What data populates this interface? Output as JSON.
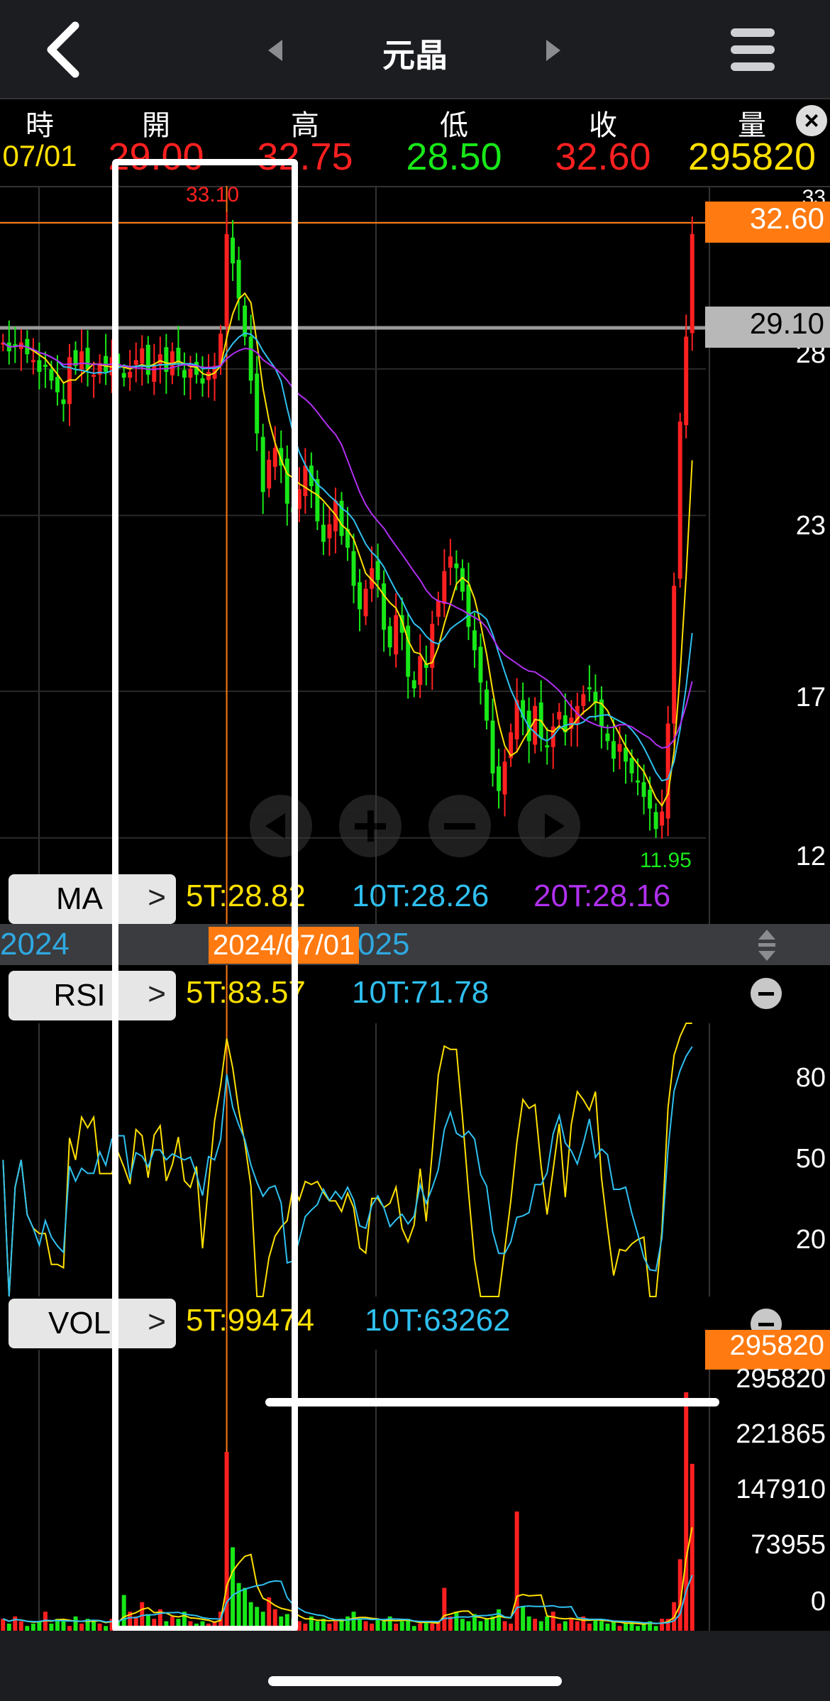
{
  "header": {
    "title": "元晶",
    "icons": [
      "back-chevron-icon",
      "prev-triangle-icon",
      "next-triangle-icon",
      "hamburger-menu-icon"
    ]
  },
  "quote": {
    "labels": [
      "時",
      "開",
      "高",
      "低",
      "收",
      "量"
    ],
    "values": [
      "07/01",
      "29.00",
      "32.75",
      "28.50",
      "32.60",
      "295820"
    ],
    "colors": [
      "#ffe000",
      "#ff2020",
      "#ff2020",
      "#18e818",
      "#ff2020",
      "#ffe000"
    ]
  },
  "price_chart": {
    "current_price_tag": "32.60",
    "ref_price_tag": "29.10",
    "high_label": "33.10",
    "low_label": "11.95",
    "axis_labels": [
      "33",
      "28",
      "23",
      "17",
      "12"
    ]
  },
  "ma": {
    "button": "MA",
    "values": [
      {
        "text": "5T:28.82",
        "color": "#ffe000"
      },
      {
        "text": "10T:28.26",
        "color": "#2fc0f0"
      },
      {
        "text": "20T:28.16",
        "color": "#b030f0"
      }
    ]
  },
  "date_axis": {
    "left_year": "2024",
    "selected_date": "2024/07/01",
    "right_year": "025"
  },
  "rsi": {
    "button": "RSI",
    "values": [
      {
        "text": "5T:83.57",
        "color": "#ffe000"
      },
      {
        "text": "10T:71.78",
        "color": "#2fc0f0"
      }
    ],
    "axis_labels": [
      "80",
      "50",
      "20"
    ]
  },
  "vol": {
    "button": "VOL",
    "values": [
      {
        "text": "5T:99474",
        "color": "#ffe000"
      },
      {
        "text": "10T:63262",
        "color": "#2fc0f0"
      }
    ],
    "current_tag": "295820",
    "axis_labels": [
      "295820",
      "221865",
      "147910",
      "73955",
      "0"
    ]
  },
  "chart_data": {
    "type": "candlestick",
    "close_series": [
      28.9,
      28.6,
      28.8,
      28.9,
      28.5,
      28.3,
      27.9,
      28.1,
      27.6,
      27.2,
      26.8,
      28.4,
      28.1,
      28.6,
      28.0,
      27.8,
      28.2,
      27.9,
      28.4,
      28.1,
      27.7,
      27.9,
      28.3,
      28.7,
      27.8,
      28.1,
      28.5,
      27.9,
      28.6,
      28.2,
      27.7,
      28.0,
      27.8,
      27.5,
      27.9,
      28.1,
      29.2,
      32.6,
      31.6,
      30.4,
      29.1,
      27.6,
      25.8,
      23.8,
      24.9,
      25.3,
      24.7,
      23.4,
      23.1,
      23.9,
      24.7,
      24.0,
      22.8,
      22.1,
      22.7,
      23.5,
      22.3,
      21.9,
      20.6,
      19.8,
      20.5,
      21.2,
      20.8,
      19.1,
      18.5,
      19.6,
      19.0,
      17.5,
      17.1,
      18.2,
      17.8,
      19.3,
      20.1,
      21.1,
      21.6,
      21.2,
      20.4,
      19.2,
      18.4,
      17.3,
      16.0,
      14.2,
      13.6,
      14.6,
      15.6,
      16.7,
      16.1,
      15.3,
      16.5,
      15.4,
      15.1,
      15.8,
      16.3,
      15.6,
      16.1,
      16.5,
      16.9,
      17.1,
      16.6,
      15.8,
      15.3,
      14.7,
      15.2,
      14.6,
      14.2,
      13.9,
      13.4,
      13.0,
      12.3,
      12.9,
      15.9,
      20.6,
      26.2,
      29.1,
      32.6
    ],
    "volume_rel": [
      0.05,
      0.03,
      0.06,
      0.04,
      0.02,
      0.03,
      0.04,
      0.08,
      0.03,
      0.05,
      0.04,
      0.02,
      0.06,
      0.03,
      0.05,
      0.04,
      0.03,
      0.02,
      0.05,
      0.04,
      0.15,
      0.08,
      0.06,
      0.12,
      0.07,
      0.05,
      0.09,
      0.04,
      0.06,
      0.05,
      0.08,
      0.04,
      0.03,
      0.04,
      0.03,
      0.04,
      0.08,
      0.75,
      0.35,
      0.2,
      0.18,
      0.12,
      0.1,
      0.08,
      0.14,
      0.09,
      0.06,
      0.07,
      0.05,
      0.04,
      0.03,
      0.06,
      0.04,
      0.05,
      0.03,
      0.04,
      0.05,
      0.06,
      0.08,
      0.05,
      0.04,
      0.03,
      0.05,
      0.04,
      0.06,
      0.03,
      0.04,
      0.05,
      0.02,
      0.03,
      0.04,
      0.03,
      0.04,
      0.18,
      0.06,
      0.08,
      0.05,
      0.04,
      0.07,
      0.04,
      0.05,
      0.06,
      0.09,
      0.04,
      0.03,
      0.5,
      0.1,
      0.06,
      0.05,
      0.04,
      0.06,
      0.08,
      0.03,
      0.04,
      0.05,
      0.04,
      0.06,
      0.03,
      0.05,
      0.04,
      0.03,
      0.04,
      0.02,
      0.03,
      0.04,
      0.02,
      0.03,
      0.04,
      0.02,
      0.05,
      0.05,
      0.12,
      0.3,
      1.0,
      0.7
    ],
    "ylim": [
      11,
      34
    ]
  }
}
